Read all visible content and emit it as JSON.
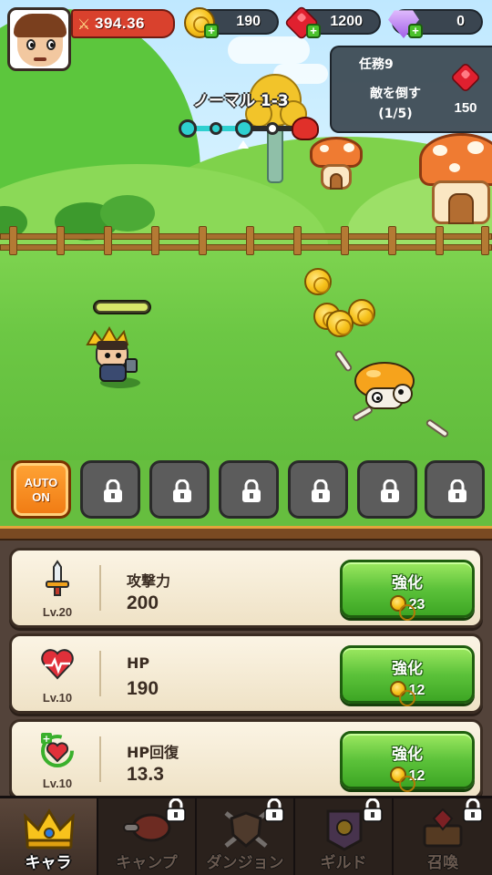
{
  "hud": {
    "power": "394.36",
    "gold": "190",
    "ruby": "1200",
    "diamond": "0"
  },
  "quest": {
    "title": "任務9",
    "description": "敵を倒す",
    "progress": "(1/5)",
    "reward": "150"
  },
  "stage": {
    "label": "ノーマル 1-3",
    "progress_fraction": 0.5
  },
  "hero": {
    "hp_fraction": 1.0
  },
  "skills": {
    "auto_label_1": "AUTO",
    "auto_label_2": "ON",
    "locked_slots": 6
  },
  "upgrades": [
    {
      "name": "攻撃力",
      "value": "200",
      "level": "Lv.20",
      "button": "強化",
      "cost": "23",
      "icon": "sword-icon"
    },
    {
      "name": "HP",
      "value": "190",
      "level": "Lv.10",
      "button": "強化",
      "cost": "12",
      "icon": "heart-icon"
    },
    {
      "name": "HP回復",
      "value": "13.3",
      "level": "Lv.10",
      "button": "強化",
      "cost": "12",
      "icon": "heart-regen-icon"
    }
  ],
  "nav": [
    {
      "label": "キャラ",
      "icon": "crown-icon",
      "locked": false,
      "active": true
    },
    {
      "label": "キャンプ",
      "icon": "meat-icon",
      "locked": true,
      "active": false
    },
    {
      "label": "ダンジョン",
      "icon": "shield-swords-icon",
      "locked": true,
      "active": false
    },
    {
      "label": "ギルド",
      "icon": "guild-banner-icon",
      "locked": true,
      "active": false
    },
    {
      "label": "召喚",
      "icon": "gem-chest-icon",
      "locked": true,
      "active": false
    }
  ],
  "colors": {
    "accent_green": "#5cc23a",
    "auto_orange": "#f07a12",
    "power_red": "#d9412d"
  }
}
